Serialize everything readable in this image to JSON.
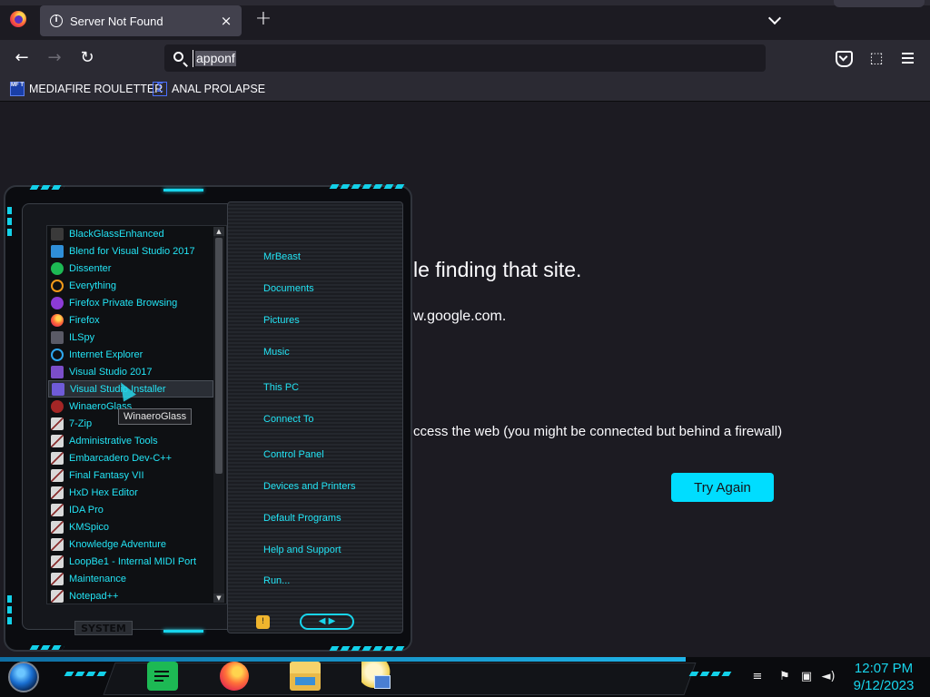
{
  "browser": {
    "tab": {
      "title": "Server Not Found"
    },
    "urlbar": {
      "value": "apponf"
    },
    "bookmarks": [
      {
        "label": "MEDIAFIRE ROULETTER",
        "favicon_text": "MF T"
      },
      {
        "label": "ANAL PROLAPSE",
        "favicon_icon": "sigma"
      }
    ],
    "icons": {
      "back": "←",
      "forward": "→",
      "reload": "↻",
      "new_tab": "+",
      "close": "×",
      "extensions": "⬚"
    }
  },
  "error_page": {
    "title_visible": "le finding that site.",
    "line1_visible": "w.google.com.",
    "line2_visible": "ccess the web (you might be connected but behind a firewall)",
    "try_again": "Try Again"
  },
  "start_menu": {
    "programs": [
      {
        "label": "BlackGlassEnhanced",
        "icon": "ic-pen"
      },
      {
        "label": "Blend for Visual Studio 2017",
        "icon": "ic-blend"
      },
      {
        "label": "Dissenter",
        "icon": "ic-spot"
      },
      {
        "label": "Everything",
        "icon": "ic-search"
      },
      {
        "label": "Firefox Private Browsing",
        "icon": "ic-mask"
      },
      {
        "label": "Firefox",
        "icon": "ic-fox"
      },
      {
        "label": "ILSpy",
        "icon": "ic-spy"
      },
      {
        "label": "Internet Explorer",
        "icon": "ic-ie"
      },
      {
        "label": "Visual Studio 2017",
        "icon": "ic-vs"
      },
      {
        "label": "Visual Studio Installer",
        "icon": "ic-vsi",
        "hover": true
      },
      {
        "label": "WinaeroGlass",
        "icon": "ic-wglass"
      },
      {
        "label": "7-Zip",
        "icon": "ic-folder"
      },
      {
        "label": "Administrative Tools",
        "icon": "ic-folder"
      },
      {
        "label": "Embarcadero Dev-C++",
        "icon": "ic-folder"
      },
      {
        "label": "Final Fantasy VII",
        "icon": "ic-folder"
      },
      {
        "label": "HxD Hex Editor",
        "icon": "ic-folder"
      },
      {
        "label": "IDA Pro",
        "icon": "ic-folder"
      },
      {
        "label": "KMSpico",
        "icon": "ic-folder"
      },
      {
        "label": "Knowledge Adventure",
        "icon": "ic-folder"
      },
      {
        "label": "LoopBe1 - Internal MIDI Port",
        "icon": "ic-folder"
      },
      {
        "label": "Maintenance",
        "icon": "ic-folder"
      },
      {
        "label": "Notepad++",
        "icon": "ic-folder"
      }
    ],
    "places": [
      {
        "label": "MrBeast"
      },
      {
        "label": "Documents"
      },
      {
        "label": "Pictures"
      },
      {
        "label": "Music"
      },
      {
        "label": "This PC"
      },
      {
        "label": "Connect To"
      },
      {
        "label": "Control Panel"
      },
      {
        "label": "Devices and Printers"
      },
      {
        "label": "Default Programs"
      },
      {
        "label": "Help and Support"
      },
      {
        "label": "Run..."
      }
    ],
    "tooltip": "WinaeroGlass",
    "system_plate": "SYSTEM",
    "accent_color": "#18d5ec"
  },
  "taskbar": {
    "apps": [
      "spotify",
      "firefox",
      "file-explorer",
      "control-panel"
    ],
    "tray": {
      "flag": "⚑",
      "network": "▣",
      "volume": "◄)"
    },
    "clock": {
      "time": "12:07 PM",
      "date": "9/12/2023"
    }
  }
}
